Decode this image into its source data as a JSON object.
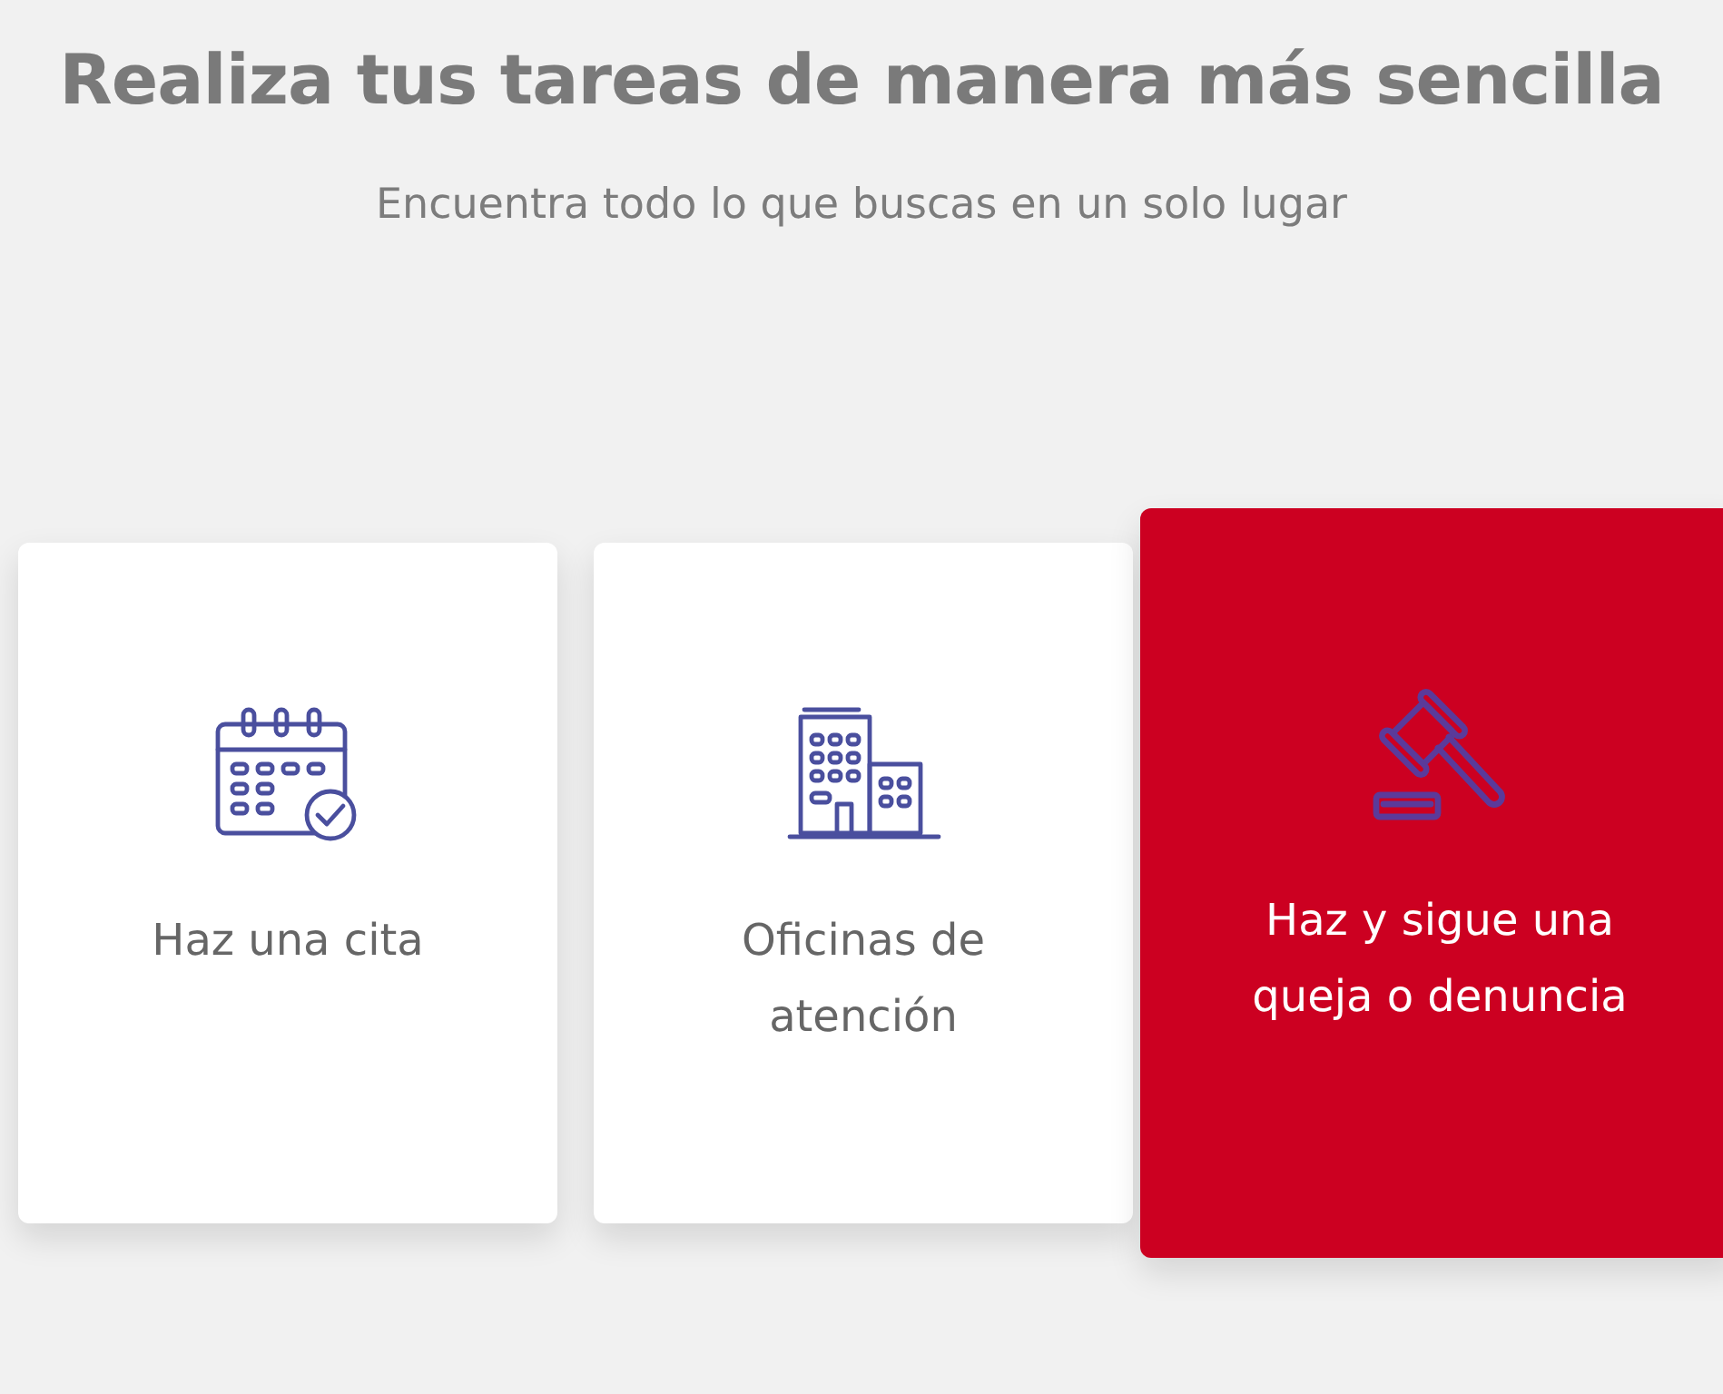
{
  "heading": "Realiza tus tareas de manera más sencilla",
  "subheading": "Encuentra todo lo que buscas en un solo lugar",
  "options": [
    {
      "label": "Haz una cita",
      "selected": false
    },
    {
      "label": "Oficinas de atención",
      "selected": false
    },
    {
      "label": "Haz y sigue una queja o denuncia",
      "selected": true
    }
  ]
}
